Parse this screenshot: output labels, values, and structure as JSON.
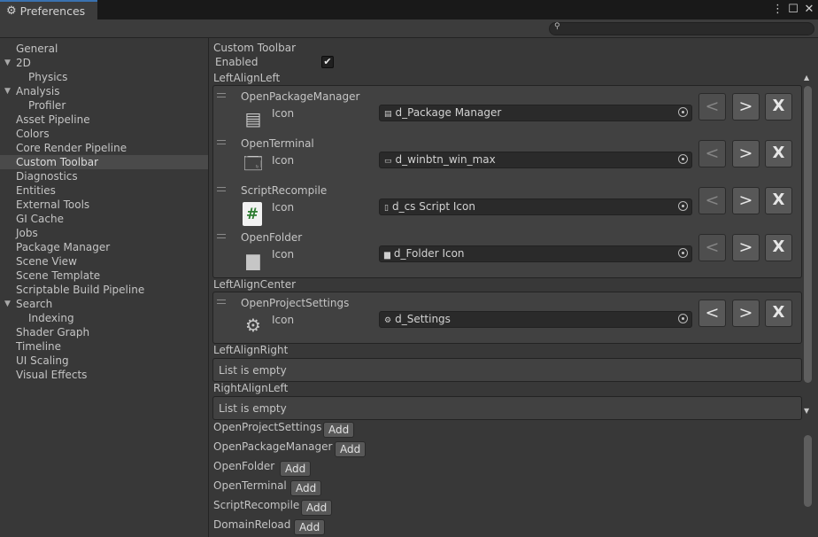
{
  "window": {
    "tab_title": "Preferences",
    "tab_icon": "gear-icon",
    "controls": [
      "more-icon",
      "maximize-icon",
      "close-icon"
    ],
    "control_glyphs": [
      "⋮",
      "☐",
      "✕"
    ]
  },
  "search": {
    "placeholder": "",
    "value": "",
    "icon": "search-icon",
    "glyph": "⚲"
  },
  "sidebar": {
    "items": [
      {
        "label": "General",
        "level": 0,
        "fold": ""
      },
      {
        "label": "2D",
        "level": 0,
        "fold": "▼"
      },
      {
        "label": "Physics",
        "level": 1,
        "fold": ""
      },
      {
        "label": "Analysis",
        "level": 0,
        "fold": "▼"
      },
      {
        "label": "Profiler",
        "level": 1,
        "fold": ""
      },
      {
        "label": "Asset Pipeline",
        "level": 0,
        "fold": ""
      },
      {
        "label": "Colors",
        "level": 0,
        "fold": ""
      },
      {
        "label": "Core Render Pipeline",
        "level": 0,
        "fold": ""
      },
      {
        "label": "Custom Toolbar",
        "level": 0,
        "fold": "",
        "selected": true
      },
      {
        "label": "Diagnostics",
        "level": 0,
        "fold": ""
      },
      {
        "label": "Entities",
        "level": 0,
        "fold": ""
      },
      {
        "label": "External Tools",
        "level": 0,
        "fold": ""
      },
      {
        "label": "GI Cache",
        "level": 0,
        "fold": ""
      },
      {
        "label": "Jobs",
        "level": 0,
        "fold": ""
      },
      {
        "label": "Package Manager",
        "level": 0,
        "fold": ""
      },
      {
        "label": "Scene View",
        "level": 0,
        "fold": ""
      },
      {
        "label": "Scene Template",
        "level": 0,
        "fold": ""
      },
      {
        "label": "Scriptable Build Pipeline",
        "level": 0,
        "fold": ""
      },
      {
        "label": "Search",
        "level": 0,
        "fold": "▼"
      },
      {
        "label": "Indexing",
        "level": 1,
        "fold": ""
      },
      {
        "label": "Shader Graph",
        "level": 0,
        "fold": ""
      },
      {
        "label": "Timeline",
        "level": 0,
        "fold": ""
      },
      {
        "label": "UI Scaling",
        "level": 0,
        "fold": ""
      },
      {
        "label": "Visual Effects",
        "level": 0,
        "fold": ""
      }
    ]
  },
  "main": {
    "section_title": "Custom Toolbar",
    "enabled_label": "Enabled",
    "enabled_checked": true,
    "check_glyph": "✔",
    "icon_label": "Icon",
    "button_labels": {
      "left": "<",
      "right": ">",
      "remove": "X"
    },
    "groups": [
      {
        "title": "LeftAlignLeft",
        "items": [
          {
            "name": "OpenPackageManager",
            "icon": "package-icon",
            "glyph": "▤",
            "field_icon": "▤",
            "field_value": "d_Package Manager",
            "left_enabled": false
          },
          {
            "name": "OpenTerminal",
            "icon": "window-icon",
            "glyph": "🗔",
            "field_icon": "▭",
            "field_value": "d_winbtn_win_max",
            "left_enabled": false
          },
          {
            "name": "ScriptRecompile",
            "icon": "cs-script-icon",
            "glyph": "#",
            "field_icon": "▯",
            "field_value": "d_cs Script Icon",
            "left_enabled": false
          },
          {
            "name": "OpenFolder",
            "icon": "folder-icon",
            "glyph": "▆",
            "field_icon": "▆",
            "field_value": "d_Folder Icon",
            "left_enabled": false
          }
        ]
      },
      {
        "title": "LeftAlignCenter",
        "items": [
          {
            "name": "OpenProjectSettings",
            "icon": "settings-icon",
            "glyph": "⚙",
            "field_icon": "⚙",
            "field_value": "d_Settings",
            "left_enabled": true
          }
        ]
      },
      {
        "title": "LeftAlignRight",
        "empty_text": "List is empty"
      },
      {
        "title": "RightAlignLeft",
        "empty_text": "List is empty"
      }
    ],
    "add_label": "Add",
    "available": [
      "OpenProjectSettings",
      "OpenPackageManager",
      "OpenFolder",
      "OpenTerminal",
      "ScriptRecompile",
      "DomainReload"
    ]
  },
  "scrollbars": {
    "upper": {
      "up_glyph": "▲",
      "down_glyph": "▼"
    }
  }
}
